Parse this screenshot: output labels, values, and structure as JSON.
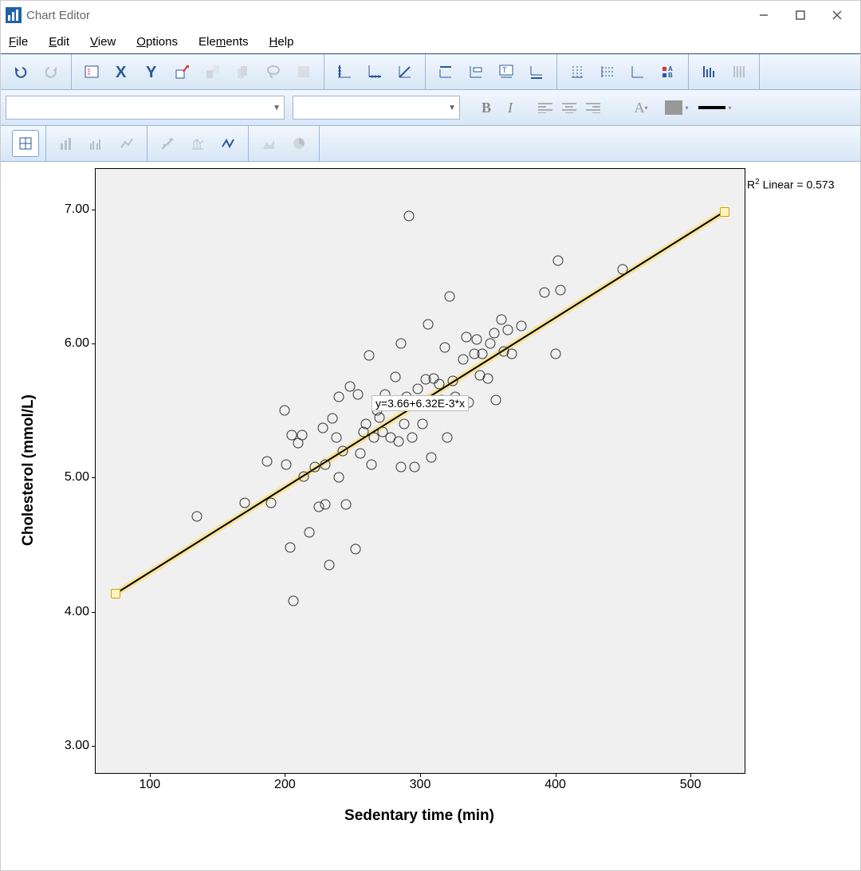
{
  "window": {
    "title": "Chart Editor"
  },
  "menubar": {
    "items": [
      {
        "hot": "F",
        "rest": "ile"
      },
      {
        "hot": "E",
        "rest": "dit"
      },
      {
        "hot": "V",
        "rest": "iew"
      },
      {
        "hot": "O",
        "rest": "ptions"
      },
      {
        "pre": "Ele",
        "hot": "m",
        "rest": "ents"
      },
      {
        "hot": "H",
        "rest": "elp"
      }
    ]
  },
  "format": {
    "bold": "B",
    "italic": "I",
    "fontA": "A"
  },
  "annotations": {
    "r2_prefix": "R",
    "r2_sup": "2",
    "r2_rest": " Linear = 0.573",
    "equation": "y=3.66+6.32E-3*x"
  },
  "chart_data": {
    "type": "scatter",
    "title": "",
    "xlabel": "Sedentary time (min)",
    "ylabel": "Cholesterol (mmol/L)",
    "xlim": [
      60,
      540
    ],
    "ylim": [
      2.8,
      7.3
    ],
    "xticks": [
      100,
      200,
      300,
      400,
      500
    ],
    "yticks": [
      3.0,
      4.0,
      5.0,
      6.0,
      7.0
    ],
    "ytick_labels": [
      "3.00",
      "4.00",
      "5.00",
      "6.00",
      "7.00"
    ],
    "fit": {
      "intercept": 3.66,
      "slope": 0.00632,
      "r2": 0.573,
      "x0": 75,
      "x1": 525
    },
    "series": [
      {
        "name": "data",
        "values": [
          [
            135,
            4.71
          ],
          [
            170,
            4.81
          ],
          [
            187,
            5.12
          ],
          [
            190,
            4.81
          ],
          [
            200,
            5.5
          ],
          [
            201,
            5.1
          ],
          [
            204,
            4.48
          ],
          [
            205,
            5.32
          ],
          [
            206,
            4.08
          ],
          [
            210,
            5.26
          ],
          [
            213,
            5.32
          ],
          [
            214,
            5.01
          ],
          [
            218,
            4.59
          ],
          [
            222,
            5.08
          ],
          [
            225,
            4.78
          ],
          [
            228,
            5.37
          ],
          [
            230,
            5.1
          ],
          [
            230,
            4.8
          ],
          [
            233,
            4.35
          ],
          [
            235,
            5.44
          ],
          [
            238,
            5.3
          ],
          [
            240,
            5.0
          ],
          [
            240,
            5.6
          ],
          [
            243,
            5.2
          ],
          [
            245,
            4.8
          ],
          [
            248,
            5.68
          ],
          [
            252,
            4.47
          ],
          [
            254,
            5.62
          ],
          [
            256,
            5.18
          ],
          [
            258,
            5.34
          ],
          [
            260,
            5.4
          ],
          [
            262,
            5.91
          ],
          [
            264,
            5.1
          ],
          [
            266,
            5.3
          ],
          [
            268,
            5.5
          ],
          [
            270,
            5.45
          ],
          [
            272,
            5.34
          ],
          [
            274,
            5.62
          ],
          [
            278,
            5.3
          ],
          [
            280,
            5.56
          ],
          [
            282,
            5.75
          ],
          [
            284,
            5.27
          ],
          [
            286,
            5.08
          ],
          [
            286,
            6.0
          ],
          [
            288,
            5.4
          ],
          [
            290,
            5.6
          ],
          [
            292,
            6.95
          ],
          [
            294,
            5.3
          ],
          [
            296,
            5.08
          ],
          [
            298,
            5.66
          ],
          [
            300,
            5.57
          ],
          [
            302,
            5.4
          ],
          [
            304,
            5.73
          ],
          [
            306,
            6.14
          ],
          [
            308,
            5.15
          ],
          [
            310,
            5.74
          ],
          [
            312,
            5.55
          ],
          [
            314,
            5.7
          ],
          [
            316,
            5.58
          ],
          [
            318,
            5.97
          ],
          [
            320,
            5.3
          ],
          [
            322,
            6.35
          ],
          [
            324,
            5.72
          ],
          [
            326,
            5.6
          ],
          [
            330,
            5.55
          ],
          [
            332,
            5.88
          ],
          [
            334,
            6.05
          ],
          [
            336,
            5.56
          ],
          [
            340,
            5.92
          ],
          [
            342,
            6.03
          ],
          [
            344,
            5.76
          ],
          [
            346,
            5.92
          ],
          [
            350,
            5.74
          ],
          [
            352,
            6.0
          ],
          [
            355,
            6.08
          ],
          [
            356,
            5.58
          ],
          [
            360,
            6.18
          ],
          [
            362,
            5.94
          ],
          [
            365,
            6.1
          ],
          [
            368,
            5.92
          ],
          [
            375,
            6.13
          ],
          [
            392,
            6.38
          ],
          [
            400,
            5.92
          ],
          [
            402,
            6.62
          ],
          [
            404,
            6.4
          ],
          [
            450,
            6.55
          ]
        ]
      }
    ]
  }
}
